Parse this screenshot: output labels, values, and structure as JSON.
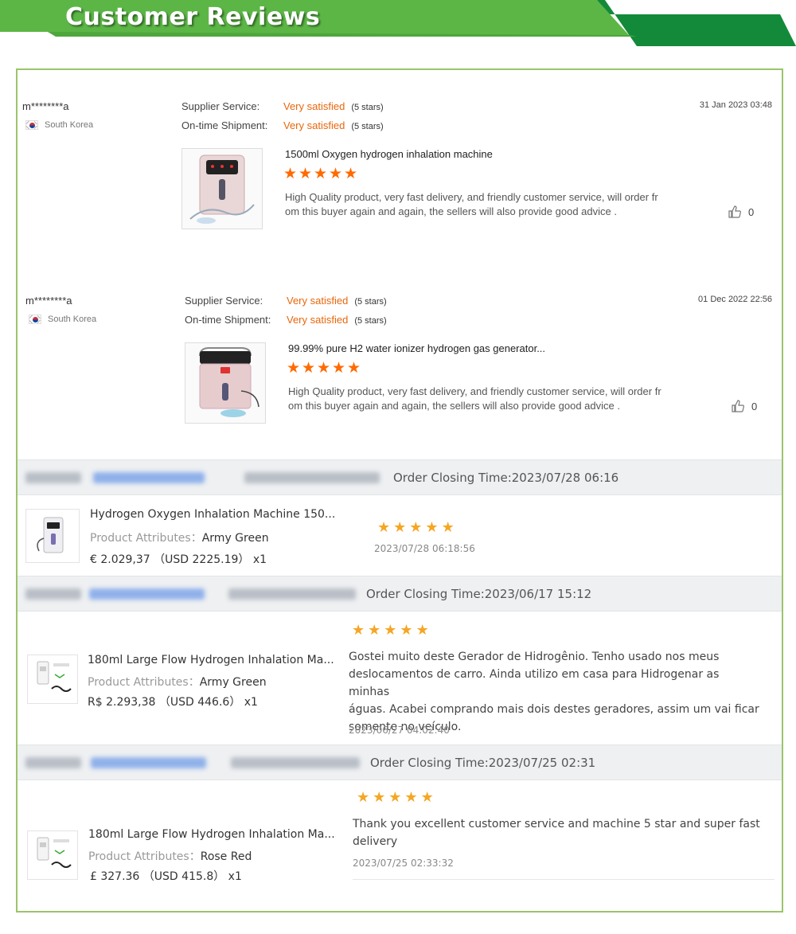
{
  "banner": {
    "title": "Customer Reviews"
  },
  "reviews": [
    {
      "user": "m********a",
      "country": "South Korea",
      "supplier_label": "Supplier Service:",
      "supplier_value": "Very satisfied",
      "supplier_stars": "(5 stars)",
      "shipment_label": "On-time Shipment:",
      "shipment_value": "Very satisfied",
      "shipment_stars": "(5 stars)",
      "date": "31 Jan 2023 03:48",
      "product": "1500ml Oxygen hydrogen inhalation machine",
      "rating": 5,
      "text_line1": "High Quality product, very fast delivery, and friendly customer service, will order fr",
      "text_line2": "om this buyer again and again, the sellers will also provide good advice .",
      "likes": "0",
      "icon": "thumbs-up-icon"
    },
    {
      "user": "m********a",
      "country": "South Korea",
      "supplier_label": "Supplier Service:",
      "supplier_value": "Very satisfied",
      "supplier_stars": "(5 stars)",
      "shipment_label": "On-time Shipment:",
      "shipment_value": "Very satisfied",
      "shipment_stars": "(5 stars)",
      "date": "01 Dec 2022 22:56",
      "product": "99.99% pure H2 water ionizer hydrogen gas generator...",
      "rating": 5,
      "text_line1": "High Quality product, very fast delivery, and friendly customer service, will order fr",
      "text_line2": "om this buyer again and again, the sellers will also provide good advice .",
      "likes": "0",
      "icon": "thumbs-up-icon"
    }
  ],
  "orders": [
    {
      "closing": "Order Closing Time:2023/07/28 06:16",
      "title": "Hydrogen Oxygen Inhalation Machine 150...",
      "attr_label": "Product Attributes：",
      "attr_value": "Army Green",
      "price": "€ 2.029,37 （USD  2225.19） x1",
      "rating": 5,
      "comment": "",
      "time": "2023/07/28 06:18:56"
    },
    {
      "closing": "Order Closing Time:2023/06/17 15:12",
      "title": "180ml Large Flow Hydrogen Inhalation Ma...",
      "attr_label": "Product Attributes：",
      "attr_value": "Army Green",
      "price": "R$ 2.293,38 （USD  446.6） x1",
      "rating": 5,
      "comment_lines": [
        "Gostei muito deste Gerador de Hidrogênio. Tenho usado nos meus",
        "deslocamentos de carro. Ainda utilizo em casa para Hidrogenar as minhas",
        "águas. Acabei comprando mais dois destes geradores, assim um vai ficar",
        "somente no veículo."
      ],
      "time": "2023/06/27 04:02:40"
    },
    {
      "closing": "Order Closing Time:2023/07/25 02:31",
      "title": "180ml Large Flow Hydrogen Inhalation Ma...",
      "attr_label": "Product Attributes：",
      "attr_value": "Rose Red",
      "price": "£ 327.36 （USD  415.8） x1",
      "rating": 5,
      "comment_lines": [
        "Thank you excellent customer service and machine 5 star and super fast",
        "delivery"
      ],
      "time": "2023/07/25 02:33:32"
    }
  ],
  "colors": {
    "accent_orange": "#e8670c",
    "star_orange": "#ff6a00",
    "star_yellow": "#f5a623",
    "banner_green_light": "#5cb646",
    "banner_green_dark": "#138a3a",
    "frame_border": "#9cc46a"
  }
}
